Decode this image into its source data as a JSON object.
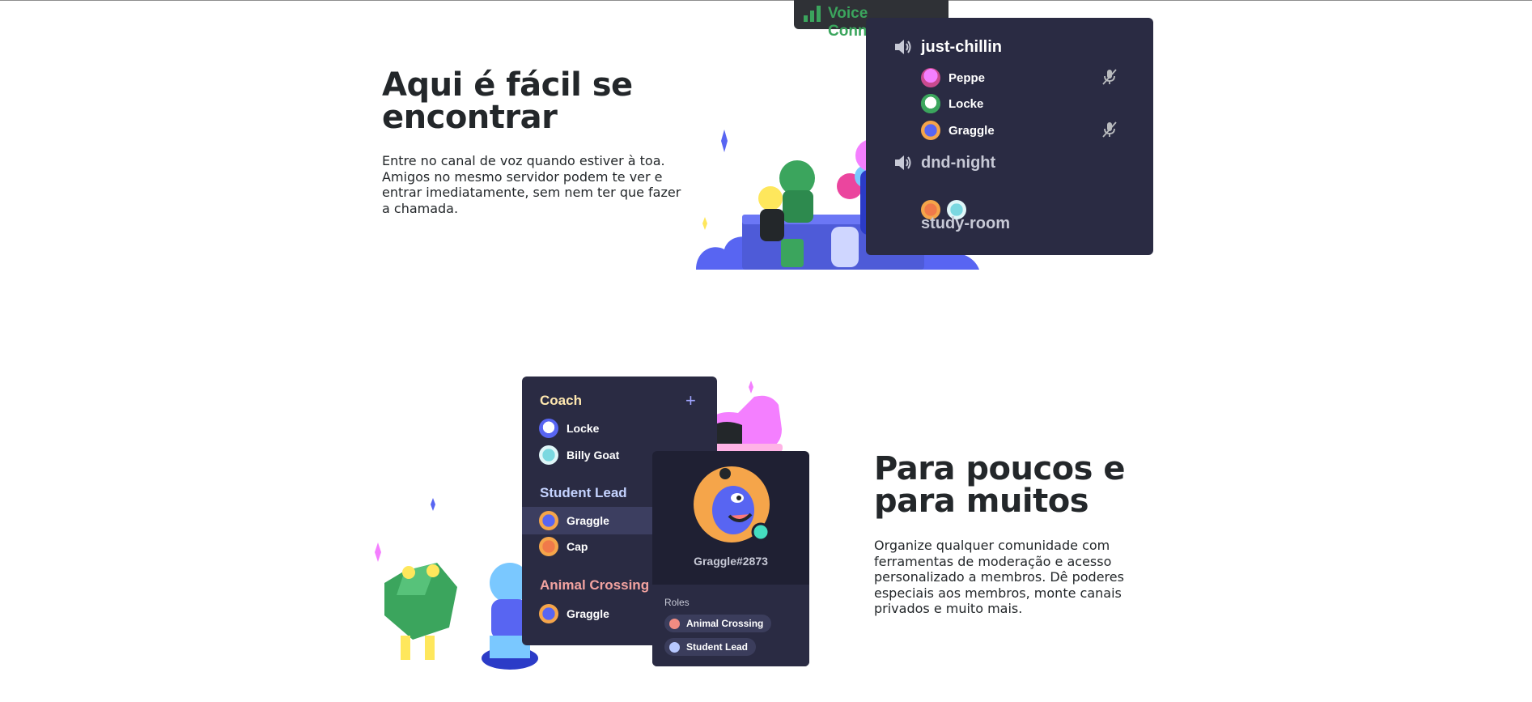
{
  "section1": {
    "heading_line1": "Aqui é fácil se",
    "heading_line2": "encontrar",
    "body_lines": [
      "Entre no canal de voz quando estiver à toa.",
      "Amigos no mesmo servidor podem te ver e",
      "entrar imediatamente, sem nem ter que fazer",
      "a chamada."
    ],
    "voice_badge": "Voice Connected",
    "channels": [
      {
        "name": "just-chillin",
        "members": [
          "Peppe",
          "Locke",
          "Graggle"
        ]
      },
      {
        "name": "dnd-night"
      },
      {
        "name": "study-room"
      }
    ]
  },
  "section2": {
    "heading_line1": "Para poucos e",
    "heading_line2": "para muitos",
    "body_lines": [
      "Organize qualquer comunidade com",
      "ferramentas de moderação e acesso",
      "personalizado a membros. Dê poderes",
      "especiais aos membros, monte canais",
      "privados e muito mais."
    ],
    "role_groups": [
      {
        "title": "Coach",
        "members": [
          "Locke",
          "Billy Goat"
        ]
      },
      {
        "title": "Student Lead",
        "members": [
          "Graggle",
          "Cap"
        ]
      },
      {
        "title": "Animal Crossing",
        "members": [
          "Graggle"
        ]
      }
    ],
    "profile": {
      "username": "Graggle#2873",
      "roles_label": "Roles",
      "roles": [
        "Animal Crossing",
        "Student Lead"
      ]
    }
  },
  "colors": {
    "panel_bg": "#2a2b43",
    "voice_green": "#3ba55d",
    "blurple": "#5865f2",
    "role_animal_crossing": "#f08c82",
    "role_student_lead": "#b7c8ff",
    "role_coach": "#ffe8b0"
  },
  "icons": [
    "signal-bars-icon",
    "speaker-icon",
    "mic-muted-icon",
    "plus-icon"
  ]
}
